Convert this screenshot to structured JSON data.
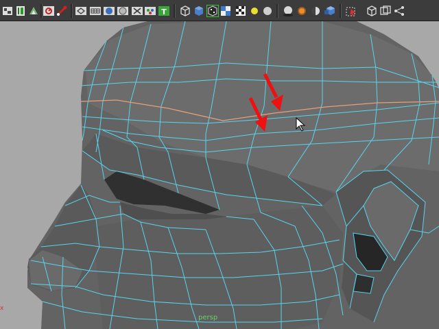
{
  "viewport": {
    "camera_label": "persp",
    "axis_marker": "x"
  },
  "colors": {
    "toolbar_bg": "#3c3c3c",
    "viewport_bg": "#a8a8a8",
    "mesh_fill": "#626262",
    "wireframe": "#57d6f0",
    "selected_edge_loop": "#e8a078",
    "annotation_arrow": "#ee1111",
    "camera_label": "#6bd06b"
  },
  "toolbar": {
    "icons": [
      "grid-snap-icon",
      "curve-snap-icon",
      "surface-snap-icon",
      "construction-history-icon",
      "render-frame-icon",
      "wireframe-shade-icon",
      "hud-icon",
      "smooth-shade-icon",
      "flat-shade-icon",
      "xray-icon",
      "texture-icon",
      "isolate-object-icon",
      "default-material-icon",
      "selection-highlight-icon",
      "texture-display-icon",
      "checker-icon",
      "light-icon",
      "bounding-box-icon",
      "shadow-icon",
      "ambient-occlusion-icon",
      "sphere-shade-icon",
      "cube-shade-icon",
      "resolution-gate-icon",
      "film-gate-icon",
      "camera-icon",
      "pivot-icon"
    ]
  }
}
